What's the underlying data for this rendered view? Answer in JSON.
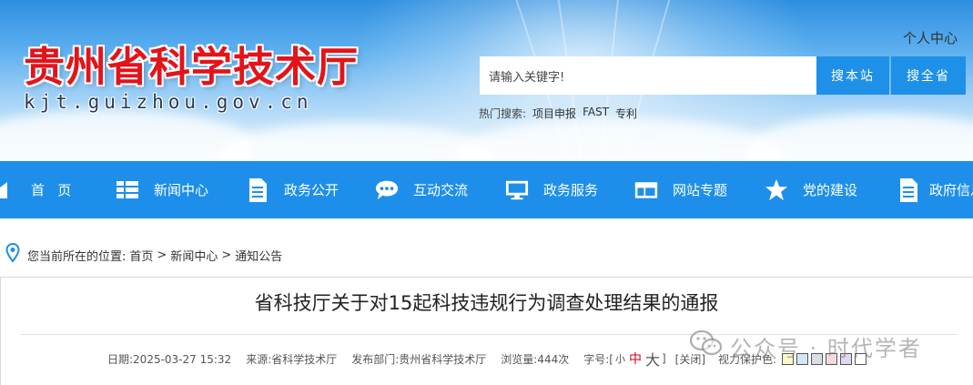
{
  "header": {
    "site_title": "贵州省科学技术厅",
    "site_domain": "kjt.guizhou.gov.cn",
    "personal_center": "个人中心",
    "search": {
      "placeholder": "请输入关键字!",
      "search_site_label": "搜本站",
      "search_all_label": "搜全省"
    },
    "hot_search": {
      "label": "热门搜索:",
      "items": [
        "项目申报",
        "FAST",
        "专利"
      ]
    }
  },
  "nav": {
    "items": [
      {
        "label": "首   页",
        "icon": "home-icon"
      },
      {
        "label": "新闻中心",
        "icon": "grid-list-icon"
      },
      {
        "label": "政务公开",
        "icon": "document-icon"
      },
      {
        "label": "互动交流",
        "icon": "chat-bubble-icon"
      },
      {
        "label": "政务服务",
        "icon": "monitor-icon"
      },
      {
        "label": "网站专题",
        "icon": "folder-window-icon"
      },
      {
        "label": "党的建设",
        "icon": "star-icon"
      },
      {
        "label": "政府信息",
        "icon": "document-icon"
      }
    ]
  },
  "breadcrumb": {
    "prefix": "您当前所在的位置:",
    "items": [
      "首页",
      "新闻中心",
      "通知公告"
    ],
    "separator": ">"
  },
  "article": {
    "title": "省科技厅关于对15起科技违规行为调查处理结果的通报",
    "meta": {
      "date": "日期:2025-03-27 15:32",
      "source": "来源:省科学技术厅",
      "department": "发布部门:贵州省科学技术厅",
      "views": "浏览量:444次",
      "font_size_label": "字号:[",
      "font_small": "小",
      "font_medium": "中",
      "font_large": "大",
      "font_size_end": "]",
      "close": "[关闭]",
      "eye_protection": "视力保护色:"
    },
    "eye_colors": [
      "#fbf7c9",
      "#cfe8f3",
      "#d9dde8",
      "#f5d9e2",
      "#e3d6f2",
      "#ffffff"
    ]
  },
  "watermark": {
    "text": "公众号 · 时代学者"
  },
  "colors": {
    "brand_blue": "#1d8fea",
    "title_red": "#e2141a"
  }
}
